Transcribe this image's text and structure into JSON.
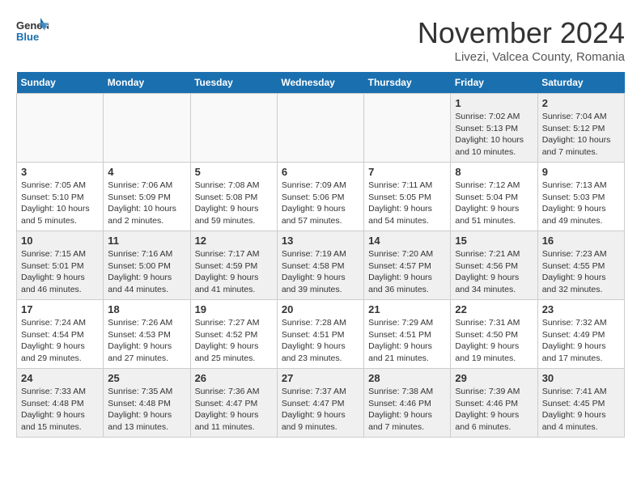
{
  "header": {
    "logo_line1": "General",
    "logo_line2": "Blue",
    "month": "November 2024",
    "location": "Livezi, Valcea County, Romania"
  },
  "weekdays": [
    "Sunday",
    "Monday",
    "Tuesday",
    "Wednesday",
    "Thursday",
    "Friday",
    "Saturday"
  ],
  "weeks": [
    [
      {
        "day": "",
        "info": ""
      },
      {
        "day": "",
        "info": ""
      },
      {
        "day": "",
        "info": ""
      },
      {
        "day": "",
        "info": ""
      },
      {
        "day": "",
        "info": ""
      },
      {
        "day": "1",
        "info": "Sunrise: 7:02 AM\nSunset: 5:13 PM\nDaylight: 10 hours and 10 minutes."
      },
      {
        "day": "2",
        "info": "Sunrise: 7:04 AM\nSunset: 5:12 PM\nDaylight: 10 hours and 7 minutes."
      }
    ],
    [
      {
        "day": "3",
        "info": "Sunrise: 7:05 AM\nSunset: 5:10 PM\nDaylight: 10 hours and 5 minutes."
      },
      {
        "day": "4",
        "info": "Sunrise: 7:06 AM\nSunset: 5:09 PM\nDaylight: 10 hours and 2 minutes."
      },
      {
        "day": "5",
        "info": "Sunrise: 7:08 AM\nSunset: 5:08 PM\nDaylight: 9 hours and 59 minutes."
      },
      {
        "day": "6",
        "info": "Sunrise: 7:09 AM\nSunset: 5:06 PM\nDaylight: 9 hours and 57 minutes."
      },
      {
        "day": "7",
        "info": "Sunrise: 7:11 AM\nSunset: 5:05 PM\nDaylight: 9 hours and 54 minutes."
      },
      {
        "day": "8",
        "info": "Sunrise: 7:12 AM\nSunset: 5:04 PM\nDaylight: 9 hours and 51 minutes."
      },
      {
        "day": "9",
        "info": "Sunrise: 7:13 AM\nSunset: 5:03 PM\nDaylight: 9 hours and 49 minutes."
      }
    ],
    [
      {
        "day": "10",
        "info": "Sunrise: 7:15 AM\nSunset: 5:01 PM\nDaylight: 9 hours and 46 minutes."
      },
      {
        "day": "11",
        "info": "Sunrise: 7:16 AM\nSunset: 5:00 PM\nDaylight: 9 hours and 44 minutes."
      },
      {
        "day": "12",
        "info": "Sunrise: 7:17 AM\nSunset: 4:59 PM\nDaylight: 9 hours and 41 minutes."
      },
      {
        "day": "13",
        "info": "Sunrise: 7:19 AM\nSunset: 4:58 PM\nDaylight: 9 hours and 39 minutes."
      },
      {
        "day": "14",
        "info": "Sunrise: 7:20 AM\nSunset: 4:57 PM\nDaylight: 9 hours and 36 minutes."
      },
      {
        "day": "15",
        "info": "Sunrise: 7:21 AM\nSunset: 4:56 PM\nDaylight: 9 hours and 34 minutes."
      },
      {
        "day": "16",
        "info": "Sunrise: 7:23 AM\nSunset: 4:55 PM\nDaylight: 9 hours and 32 minutes."
      }
    ],
    [
      {
        "day": "17",
        "info": "Sunrise: 7:24 AM\nSunset: 4:54 PM\nDaylight: 9 hours and 29 minutes."
      },
      {
        "day": "18",
        "info": "Sunrise: 7:26 AM\nSunset: 4:53 PM\nDaylight: 9 hours and 27 minutes."
      },
      {
        "day": "19",
        "info": "Sunrise: 7:27 AM\nSunset: 4:52 PM\nDaylight: 9 hours and 25 minutes."
      },
      {
        "day": "20",
        "info": "Sunrise: 7:28 AM\nSunset: 4:51 PM\nDaylight: 9 hours and 23 minutes."
      },
      {
        "day": "21",
        "info": "Sunrise: 7:29 AM\nSunset: 4:51 PM\nDaylight: 9 hours and 21 minutes."
      },
      {
        "day": "22",
        "info": "Sunrise: 7:31 AM\nSunset: 4:50 PM\nDaylight: 9 hours and 19 minutes."
      },
      {
        "day": "23",
        "info": "Sunrise: 7:32 AM\nSunset: 4:49 PM\nDaylight: 9 hours and 17 minutes."
      }
    ],
    [
      {
        "day": "24",
        "info": "Sunrise: 7:33 AM\nSunset: 4:48 PM\nDaylight: 9 hours and 15 minutes."
      },
      {
        "day": "25",
        "info": "Sunrise: 7:35 AM\nSunset: 4:48 PM\nDaylight: 9 hours and 13 minutes."
      },
      {
        "day": "26",
        "info": "Sunrise: 7:36 AM\nSunset: 4:47 PM\nDaylight: 9 hours and 11 minutes."
      },
      {
        "day": "27",
        "info": "Sunrise: 7:37 AM\nSunset: 4:47 PM\nDaylight: 9 hours and 9 minutes."
      },
      {
        "day": "28",
        "info": "Sunrise: 7:38 AM\nSunset: 4:46 PM\nDaylight: 9 hours and 7 minutes."
      },
      {
        "day": "29",
        "info": "Sunrise: 7:39 AM\nSunset: 4:46 PM\nDaylight: 9 hours and 6 minutes."
      },
      {
        "day": "30",
        "info": "Sunrise: 7:41 AM\nSunset: 4:45 PM\nDaylight: 9 hours and 4 minutes."
      }
    ]
  ]
}
